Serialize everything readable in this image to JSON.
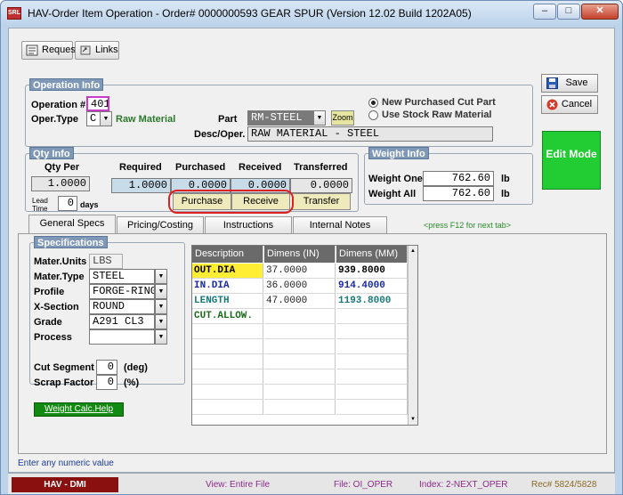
{
  "window": {
    "title": "HAV-Order Item Operation - Order# 0000000593 GEAR SPUR     (Version 12.02   Build 1202A05)",
    "icon_text": "SRL",
    "buttons": [
      "minimize-icon",
      "maximize-icon",
      "close-icon"
    ]
  },
  "toolbar": {
    "request_label": "Request",
    "links_label": "Links"
  },
  "side_buttons": {
    "save_label": "Save",
    "cancel_label": "Cancel",
    "edit_mode_label": "Edit Mode",
    "edit_mode_color": "#22cc33"
  },
  "operation_info": {
    "title": "Operation Info",
    "operation_label": "Operation #",
    "operation_value": "401",
    "oper_type_label": "Oper.Type",
    "oper_type_value": "C",
    "oper_type_desc": "Raw Material",
    "part_label": "Part",
    "part_value": "RM-STEEL",
    "zoom_label": "Zoom",
    "desc_label": "Desc/Oper.",
    "desc_value": "RAW MATERIAL - STEEL",
    "radio_new": "New Purchased Cut Part",
    "radio_stock": "Use Stock Raw Material",
    "radio_selected": "new"
  },
  "qty_info": {
    "title": "Qty Info",
    "qty_per_label": "Qty Per",
    "qty_per_value": "1.0000",
    "lead_time_label": "Lead Time",
    "lead_time_value": "0",
    "days_label": "days",
    "required_label": "Required",
    "required_value": "1.0000",
    "purchased_label": "Purchased",
    "purchased_value": "0.0000",
    "received_label": "Received",
    "received_value": "0.0000",
    "transferred_label": "Transferred",
    "transferred_value": "0.0000",
    "purchase_btn": "Purchase",
    "receive_btn": "Receive",
    "transfer_btn": "Transfer"
  },
  "weight_info": {
    "title": "Weight Info",
    "weight_one_label": "Weight One",
    "weight_one_value": "762.60",
    "weight_all_label": "Weight All",
    "weight_all_value": "762.60",
    "unit": "lb"
  },
  "tabs": [
    {
      "label": "General Specs",
      "active": true
    },
    {
      "label": "Pricing/Costing",
      "active": false
    },
    {
      "label": "Instructions",
      "active": false
    },
    {
      "label": "Internal Notes",
      "active": false
    }
  ],
  "tab_hint": "<press F12 for next tab>",
  "specifications": {
    "title": "Specifications",
    "mater_units_label": "Mater.Units",
    "mater_units_value": "LBS",
    "mater_type_label": "Mater.Type",
    "mater_type_value": "STEEL",
    "profile_label": "Profile",
    "profile_value": "FORGE-RING",
    "xsection_label": "X-Section",
    "xsection_value": "ROUND",
    "grade_label": "Grade",
    "grade_value": "A291 CL3",
    "process_label": "Process",
    "process_value": "",
    "cut_segment_label": "Cut Segment",
    "cut_segment_value": "0",
    "cut_segment_unit": "(deg)",
    "scrap_factor_label": "Scrap Factor",
    "scrap_factor_value": "0",
    "scrap_factor_unit": "(%)",
    "weight_calc_help": "Weight Calc.Help"
  },
  "dimensions_grid": {
    "headers": [
      "Description",
      "Dimens (IN)",
      "Dimens (MM)"
    ],
    "rows": [
      {
        "desc": "OUT.DIA",
        "in": "37.0000",
        "mm": "939.8000",
        "color": "#000000",
        "highlight": true
      },
      {
        "desc": "IN.DIA",
        "in": "36.0000",
        "mm": "914.4000",
        "color": "#1a2aa0",
        "highlight": false
      },
      {
        "desc": "LENGTH",
        "in": "47.0000",
        "mm": "1193.8000",
        "color": "#1a7a7a",
        "highlight": false
      },
      {
        "desc": "CUT.ALLOW.",
        "in": "",
        "mm": "",
        "color": "#1a6a1a",
        "highlight": false
      }
    ]
  },
  "hint_text": "Enter any numeric value",
  "statusbar": {
    "app": "HAV - DMI",
    "view": "View: Entire File",
    "file": "File: OI_OPER",
    "index": "Index: 2-NEXT_OPER",
    "rec": "Rec# 5824/5828"
  }
}
